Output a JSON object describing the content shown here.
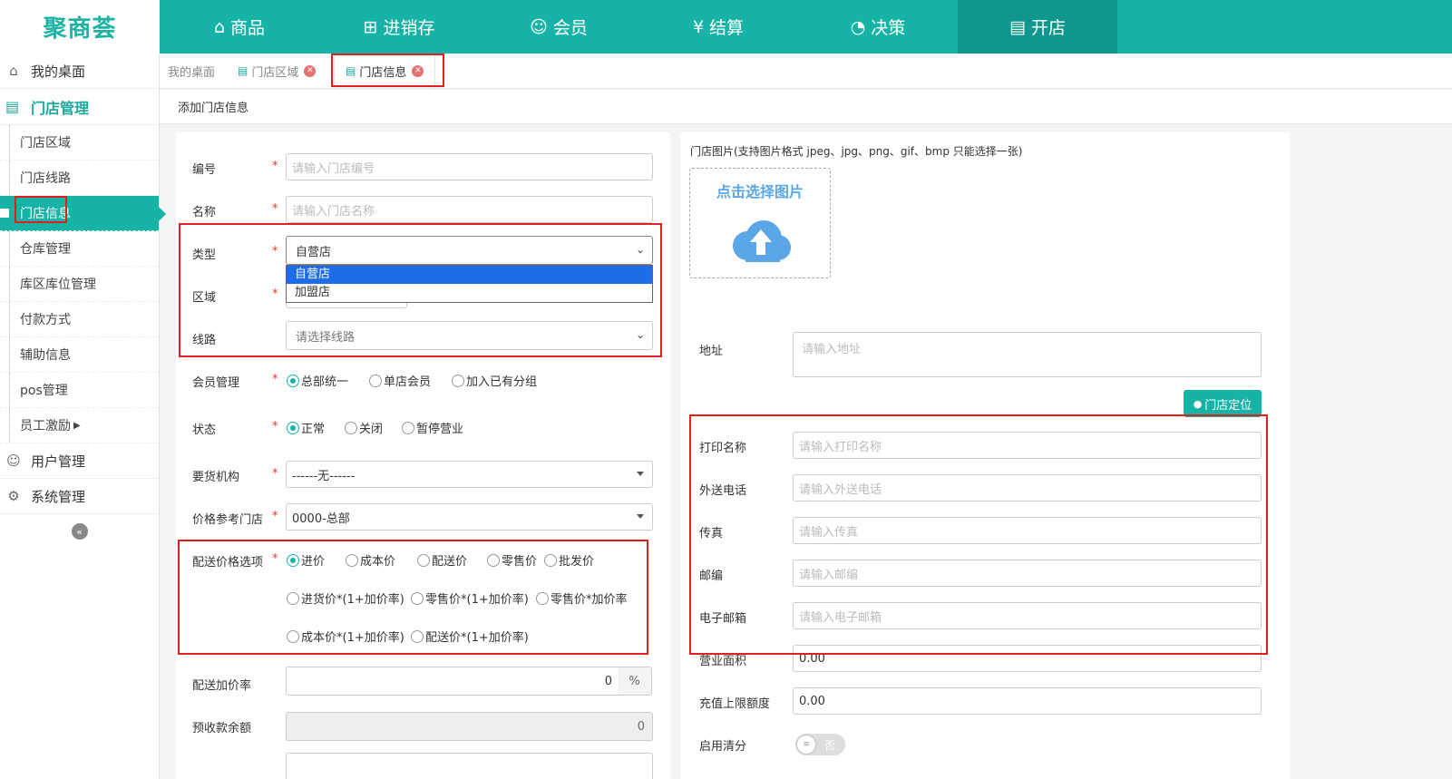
{
  "brand": {
    "logo": "聚商荟"
  },
  "nav": [
    {
      "label": "商品",
      "icon": "bag-icon"
    },
    {
      "label": "进销存",
      "icon": "inventory-icon"
    },
    {
      "label": "会员",
      "icon": "members-icon"
    },
    {
      "label": "结算",
      "icon": "settlement-icon"
    },
    {
      "label": "决策",
      "icon": "decision-icon"
    },
    {
      "label": "开店",
      "icon": "store-icon"
    }
  ],
  "sidebar": {
    "desktop": "我的桌面",
    "store_mgmt": "门店管理",
    "items": [
      "门店区域",
      "门店线路",
      "门店信息",
      "仓库管理",
      "库区库位管理",
      "付款方式",
      "辅助信息",
      "pos管理",
      "员工激励"
    ],
    "user_mgmt": "用户管理",
    "system_mgmt": "系统管理"
  },
  "tabs": [
    {
      "label": "我的桌面"
    },
    {
      "label": "门店区域"
    },
    {
      "label": "门店信息"
    }
  ],
  "page": {
    "breadcrumb": "添加门店信息"
  },
  "form_left": {
    "code": {
      "label": "编号",
      "placeholder": "请输入门店编号"
    },
    "name": {
      "label": "名称",
      "placeholder": "请输入门店名称"
    },
    "type": {
      "label": "类型",
      "value": "自营店",
      "options": [
        "自营店",
        "加盟店"
      ]
    },
    "region": {
      "label": "区域"
    },
    "route": {
      "label": "线路",
      "placeholder": "请选择线路"
    },
    "member_mgmt": {
      "label": "会员管理",
      "options": [
        "总部统一",
        "单店会员",
        "加入已有分组"
      ]
    },
    "status": {
      "label": "状态",
      "options": [
        "正常",
        "关闭",
        "暂停营业"
      ]
    },
    "supplier": {
      "label": "要货机构",
      "value": "------无------"
    },
    "price_ref": {
      "label": "价格参考门店",
      "value": "0000-总部"
    },
    "delivery_price": {
      "label": "配送价格选项",
      "options": [
        "进价",
        "成本价",
        "配送价",
        "零售价",
        "批发价",
        "进货价*(1+加价率)",
        "零售价*(1+加价率)",
        "零售价*加价率",
        "成本价*(1+加价率)",
        "配送价*(1+加价率)"
      ]
    },
    "markup": {
      "label": "配送加价率",
      "value": "0",
      "unit": "%"
    },
    "prepaid": {
      "label": "预收款余额",
      "value": "0"
    }
  },
  "form_right": {
    "image_label": "门店图片(支持图片格式 jpeg、jpg、png、gif、bmp 只能选择一张)",
    "upload_text": "点击选择图片",
    "address": {
      "label": "地址",
      "placeholder": "请输入地址"
    },
    "locate_btn": "门店定位",
    "print_name": {
      "label": "打印名称",
      "placeholder": "请输入打印名称"
    },
    "phone": {
      "label": "外送电话",
      "placeholder": "请输入外送电话"
    },
    "fax": {
      "label": "传真",
      "placeholder": "请输入传真"
    },
    "zip": {
      "label": "邮编",
      "placeholder": "请输入邮编"
    },
    "email": {
      "label": "电子邮箱",
      "placeholder": "请输入电子邮箱"
    },
    "area": {
      "label": "营业面积",
      "value": "0.00"
    },
    "recharge_limit": {
      "label": "充值上限额度",
      "value": "0.00"
    },
    "clearance": {
      "label": "启用清分",
      "toggle": "否"
    }
  },
  "colors": {
    "accent": "#18b3a7",
    "highlight": "#e02020"
  }
}
